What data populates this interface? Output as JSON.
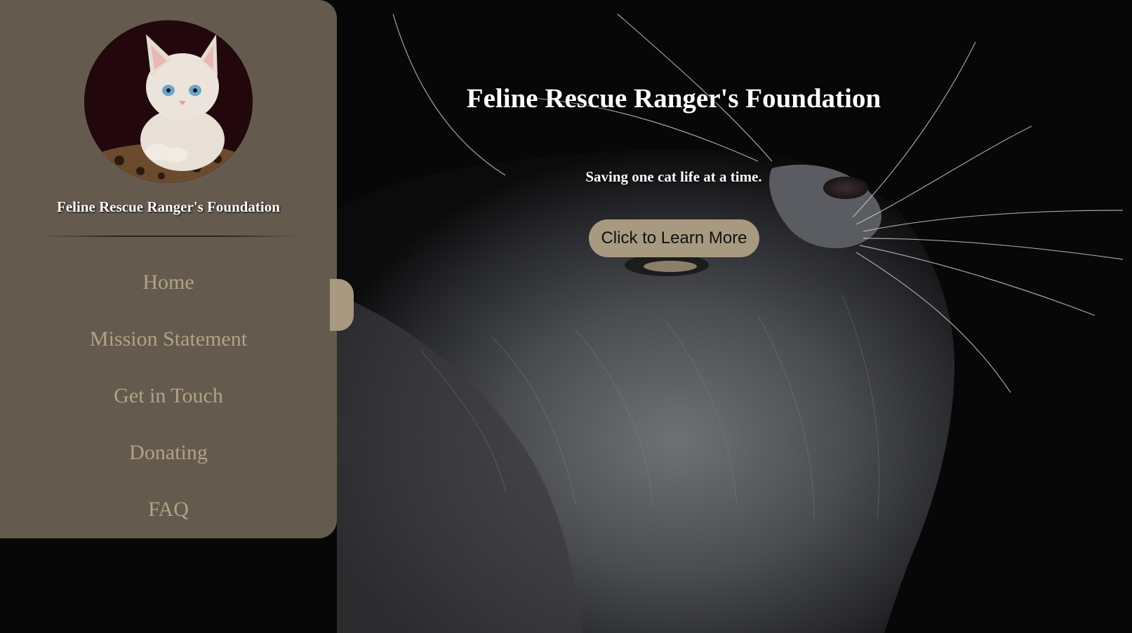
{
  "hero": {
    "title": "Feline Rescue Ranger's Foundation",
    "subtitle": "Saving one cat life at a time.",
    "cta_label": "Click to Learn More"
  },
  "sidebar": {
    "title": "Feline Rescue Ranger's Foundation",
    "nav": [
      {
        "label": "Home"
      },
      {
        "label": "Mission Statement"
      },
      {
        "label": "Get in Touch"
      },
      {
        "label": "Donating"
      },
      {
        "label": "FAQ"
      }
    ]
  },
  "colors": {
    "sidebar_bg": "#655a4e",
    "nav_text": "#b3a286",
    "button_bg": "#a89a80",
    "page_bg": "#050505"
  },
  "images": {
    "background": "gray-cat-looking-up-photo",
    "avatar": "white-kitten-photo"
  }
}
